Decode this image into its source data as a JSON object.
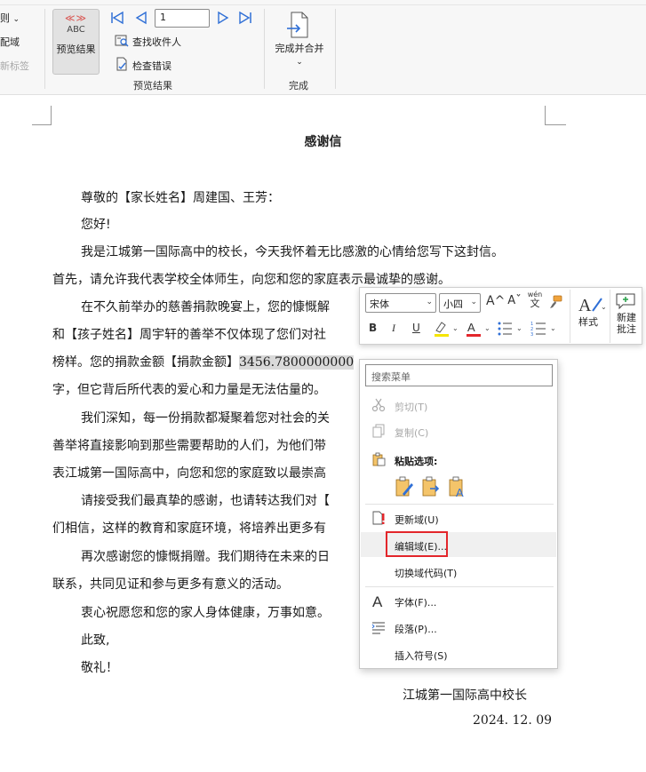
{
  "ribbon": {
    "partial_rule": "则",
    "partial_match_fields": "配域",
    "partial_update_labels": "新标签",
    "preview_results_icon_text": "ABC",
    "preview_results_chevrons": "≪≫",
    "preview_results_button": "预览结果",
    "record_number": "1",
    "find_recipient": "查找收件人",
    "check_errors": "检查错误",
    "group_preview": "预览结果",
    "finish_merge_button": "完成并合并",
    "finish_merge_caret": "⌄",
    "group_finish": "完成",
    "rule_caret": "⌄"
  },
  "document": {
    "title": "感谢信",
    "lines": [
      "尊敬的【家长姓名】周建国、王芳：",
      "您好!",
      "我是江城第一国际高中的校长，今天我怀着无比感激的心情给您写下这封信。",
      "首先，请允许我代表学校全体师生，向您和您的家庭表示最诚挚的感谢。",
      "在不久前举办的慈善捐款晚宴上，您的慷慨解",
      "和【孩子姓名】周宇轩的善举不仅体现了您们对社",
      "榜样。您的捐款金额【捐款金额】",
      "3456.7800000000",
      "字，但它背后所代表的爱心和力量是无法估量的。",
      "我们深知，每一份捐款都凝聚着您对社会的关",
      "善举将直接影响到那些需要帮助的人们，为他们带",
      "表江城第一国际高中，向您和您的家庭致以最崇高",
      "请接受我们最真挚的感谢，也请转达我们对【",
      "们相信，这样的教育和家庭环境，将培养出更多有",
      "再次感谢您的慷慨捐赠。我们期待在未来的日",
      "联系，共同见证和参与更多有意义的活动。",
      "衷心祝愿您和您的家人身体健康，万事如意。",
      "此致,",
      "敬礼！"
    ],
    "signature": "江城第一国际高中校长",
    "date": "2024. 12. 09"
  },
  "mini_toolbar": {
    "font": "宋体",
    "size": "小四",
    "grow_font": "A^",
    "shrink_font": "Aˇ",
    "phonetic_top": "wén",
    "phonetic_bottom": "文",
    "bold": "B",
    "italic": "I",
    "underline": "U",
    "styles": "样式",
    "new_comment_line1": "新建",
    "new_comment_line2": "批注",
    "highlight_color": "#f5e500",
    "font_color": "#e3262b"
  },
  "context_menu": {
    "search_placeholder": "搜索菜单",
    "cut": "剪切(T)",
    "copy": "复制(C)",
    "paste_options": "粘贴选项:",
    "update_field": "更新域(U)",
    "edit_field": "编辑域(E)...",
    "toggle_field_codes": "切换域代码(T)",
    "font": "字体(F)...",
    "paragraph": "段落(P)...",
    "insert_symbol": "插入符号(S)"
  },
  "colors": {
    "accent": "#2f6fd6",
    "highlight_box": "#e3262b",
    "field_shading": "#d9d9d9"
  }
}
